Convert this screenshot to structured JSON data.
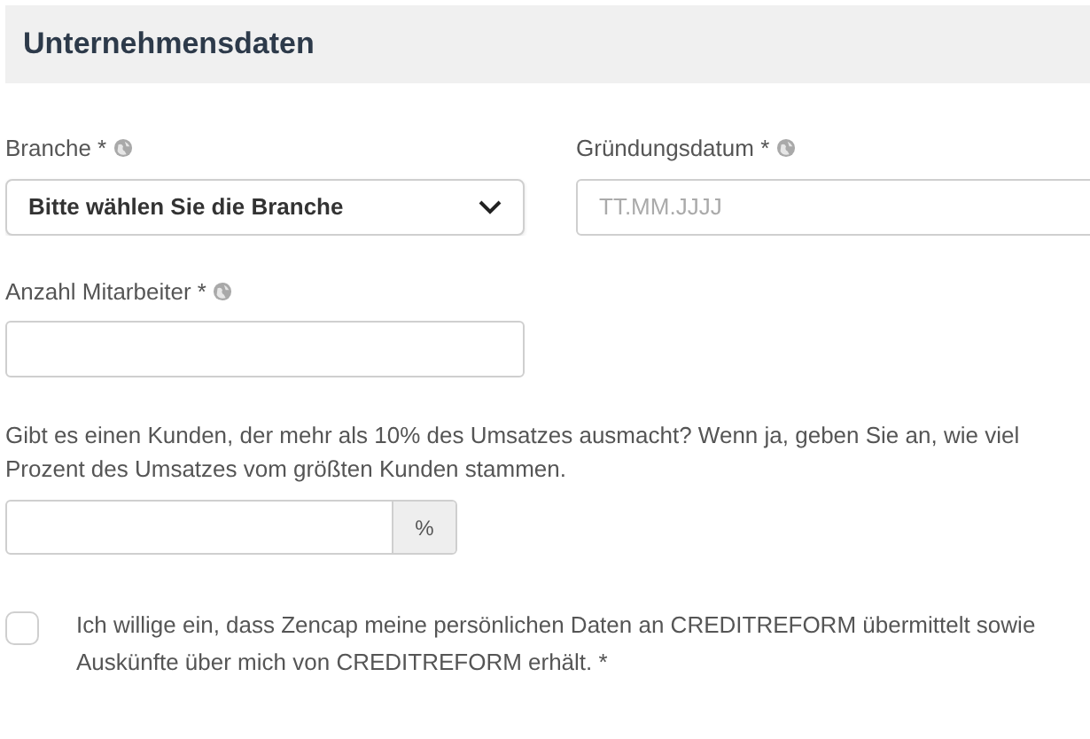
{
  "section_title": "Unternehmensdaten",
  "fields": [
    {
      "kind": "select",
      "label": "Branche *",
      "value": "Bitte wählen Sie die Branche"
    },
    {
      "kind": "input",
      "label": "Gründungsdatum *",
      "placeholder": "TT.MM.JJJJ"
    },
    {
      "kind": "input",
      "label": "Anzahl Mitarbeiter *"
    }
  ],
  "question": {
    "text": "Gibt es einen Kunden, der mehr als 10% des Umsatzes ausmacht? Wenn ja, geben Sie an, wie viel Prozent des Umsatzes vom größten Kunden stammen.",
    "addon": "%"
  },
  "consent": {
    "checked": false,
    "text": "Ich willige ein, dass Zencap meine persönlichen Daten an CREDITREFORM übermittelt sowie Auskünfte über mich von CREDITREFORM erhält. *"
  }
}
